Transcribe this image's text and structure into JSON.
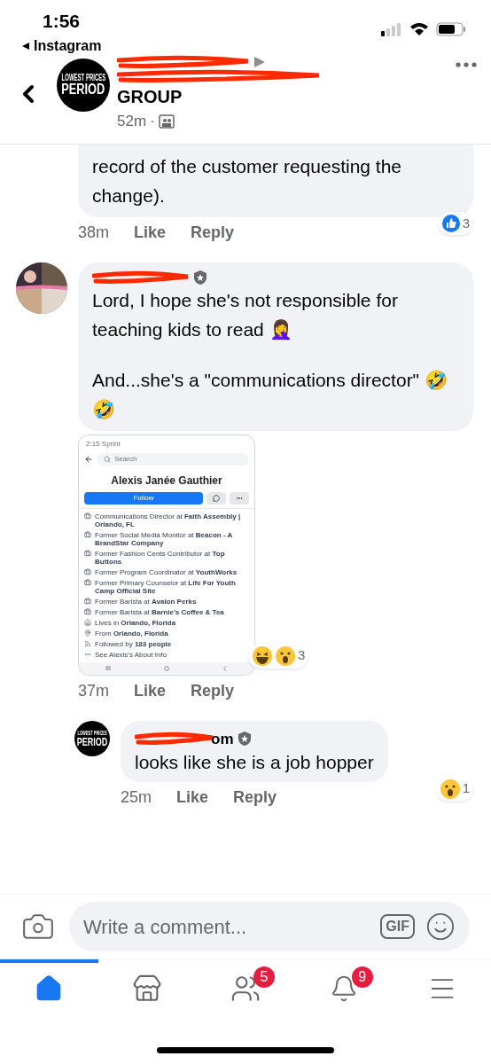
{
  "status_bar": {
    "time": "1:56",
    "back_app": "Instagram"
  },
  "header": {
    "avatar_logo": [
      "LOWEST PRICES",
      "PERIOD"
    ],
    "title_end": "GROUP",
    "time": "52m",
    "separator": "·"
  },
  "comments": [
    {
      "kind": "comment",
      "cut_top": true,
      "paragraphs": [
        "record of the customer requesting the change)."
      ],
      "time": "38m",
      "like": "Like",
      "reply": "Reply",
      "reactions": {
        "kind": "like",
        "count": "3"
      }
    },
    {
      "kind": "comment",
      "cut_top": false,
      "paragraphs": [
        "Lord, I hope she's not responsible for teaching kids to read 🤦‍♀️",
        "And...she's a \"communications director\" 🤣🤣"
      ],
      "time": "37m",
      "like": "Like",
      "reply": "Reply",
      "reactions": {
        "kind": "laugh-wow",
        "count": "3"
      },
      "attachment": {
        "status": "2:15 Sprint",
        "search": "Search",
        "name": "Alexis Janée Gauthier",
        "follow": "Follow",
        "items": [
          {
            "kind": "work",
            "text": "Communications Director at **Faith Assembly | Orlando, FL**"
          },
          {
            "kind": "work",
            "text": "Former Social Media Monitor at **Beacon - A BrandStar Company**"
          },
          {
            "kind": "work",
            "text": "Former Fashion Cents Contributor at **Top Buttons**"
          },
          {
            "kind": "work",
            "text": "Former Program Coordinator at **YouthWorks**"
          },
          {
            "kind": "work",
            "text": "Former Primary Counselor at **Life For Youth Camp Official Site**"
          },
          {
            "kind": "work",
            "text": "Former Barista at **Avalon Perks**"
          },
          {
            "kind": "work",
            "text": "Former Barista at **Barnie's Coffee & Tea**"
          },
          {
            "kind": "home",
            "text": "Lives in **Orlando, Florida**"
          },
          {
            "kind": "pin",
            "text": "From **Orlando, Florida**"
          },
          {
            "kind": "follow",
            "text": "Followed by **183 people**"
          },
          {
            "kind": "more",
            "text": "See Alexis's About Info"
          }
        ]
      }
    },
    {
      "kind": "reply",
      "cut_top": false,
      "avatar_logo": [
        "LOWEST PRICES",
        "PERIOD"
      ],
      "name_end": "om",
      "paragraphs": [
        "looks like she is a job hopper"
      ],
      "time": "25m",
      "like": "Like",
      "reply": "Reply",
      "reactions": {
        "kind": "wow",
        "count": "1"
      }
    }
  ],
  "composer": {
    "placeholder": "Write a comment...",
    "gif": "GIF"
  },
  "nav": [
    {
      "kind": "home",
      "selected": true
    },
    {
      "kind": "marketplace",
      "selected": false
    },
    {
      "kind": "groups",
      "selected": false,
      "badge": "5"
    },
    {
      "kind": "notifications",
      "selected": false,
      "badge": "9"
    },
    {
      "kind": "menu",
      "selected": false
    }
  ]
}
